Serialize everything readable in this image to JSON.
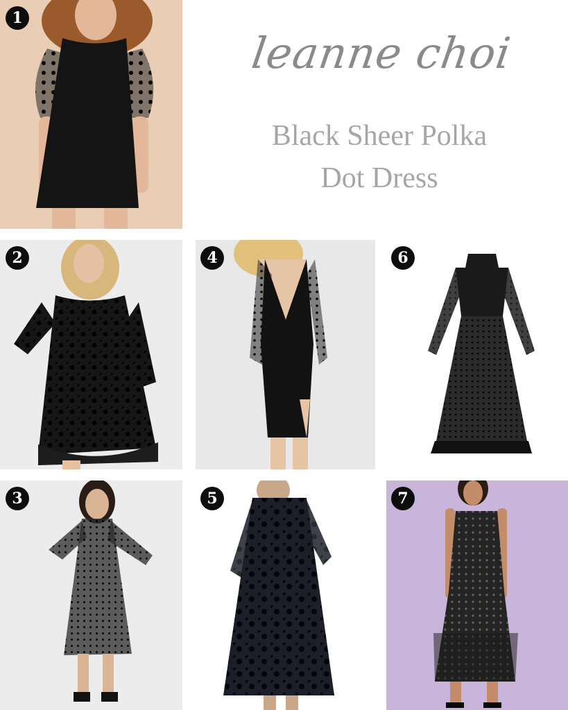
{
  "header": {
    "brand": "leanne choi",
    "title_line1": "Black Sheer Polka",
    "title_line2": "Dot Dress"
  },
  "products": [
    {
      "number": "1"
    },
    {
      "number": "2"
    },
    {
      "number": "3"
    },
    {
      "number": "4"
    },
    {
      "number": "5"
    },
    {
      "number": "6"
    },
    {
      "number": "7"
    }
  ],
  "colors": {
    "badge": "#0d0d0d",
    "dress": "#141414",
    "title_text": "#a6a6a6",
    "tile1_bg": "#e9cdb4",
    "tile7_bg": "#c8b4d8"
  }
}
